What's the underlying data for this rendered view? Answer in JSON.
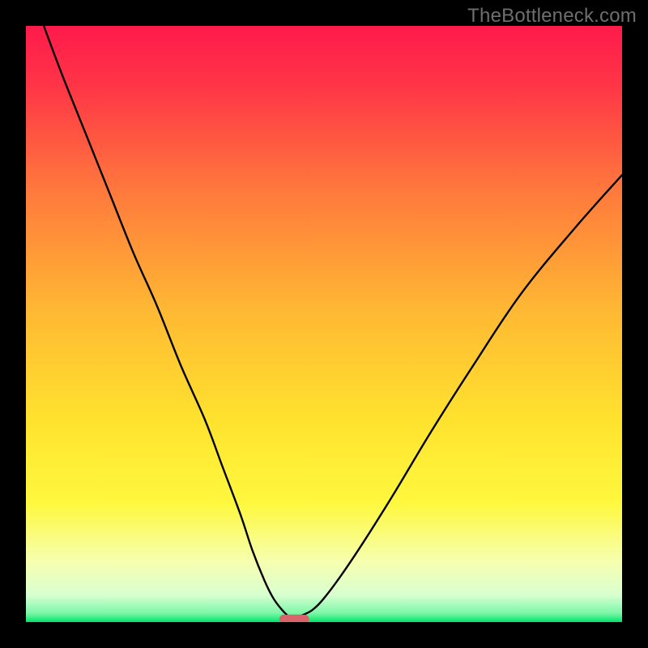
{
  "watermark": "TheBottleneck.com",
  "chart_data": {
    "type": "line",
    "title": "",
    "xlabel": "",
    "ylabel": "",
    "xlim": [
      0,
      100
    ],
    "ylim": [
      0,
      100
    ],
    "grid": false,
    "legend": false,
    "background_gradient": {
      "stops": [
        {
          "offset": 0.0,
          "color": "#ff1a4b"
        },
        {
          "offset": 0.1,
          "color": "#ff3547"
        },
        {
          "offset": 0.28,
          "color": "#ff7a3c"
        },
        {
          "offset": 0.48,
          "color": "#ffb933"
        },
        {
          "offset": 0.66,
          "color": "#ffe22e"
        },
        {
          "offset": 0.8,
          "color": "#fff83e"
        },
        {
          "offset": 0.9,
          "color": "#f6ffb0"
        },
        {
          "offset": 0.955,
          "color": "#d8ffd0"
        },
        {
          "offset": 0.985,
          "color": "#7cf7a7"
        },
        {
          "offset": 1.0,
          "color": "#00e36b"
        }
      ]
    },
    "series": [
      {
        "name": "left-branch",
        "x": [
          3,
          6,
          10,
          14,
          18,
          22,
          26,
          30,
          33,
          36,
          38,
          40,
          41.5,
          43,
          44
        ],
        "y": [
          100,
          92,
          82,
          72,
          62,
          53,
          43,
          34,
          26,
          18,
          12,
          7,
          4,
          2,
          1
        ]
      },
      {
        "name": "right-branch",
        "x": [
          46,
          48,
          50,
          53,
          57,
          62,
          68,
          75,
          83,
          92,
          100
        ],
        "y": [
          1,
          2,
          4,
          8,
          14,
          22,
          32,
          43,
          55,
          66,
          75
        ]
      }
    ],
    "marker": {
      "name": "bottom-marker",
      "x": 45,
      "y": 0.5,
      "width": 5,
      "height": 1.5,
      "color": "#d9636a"
    }
  }
}
